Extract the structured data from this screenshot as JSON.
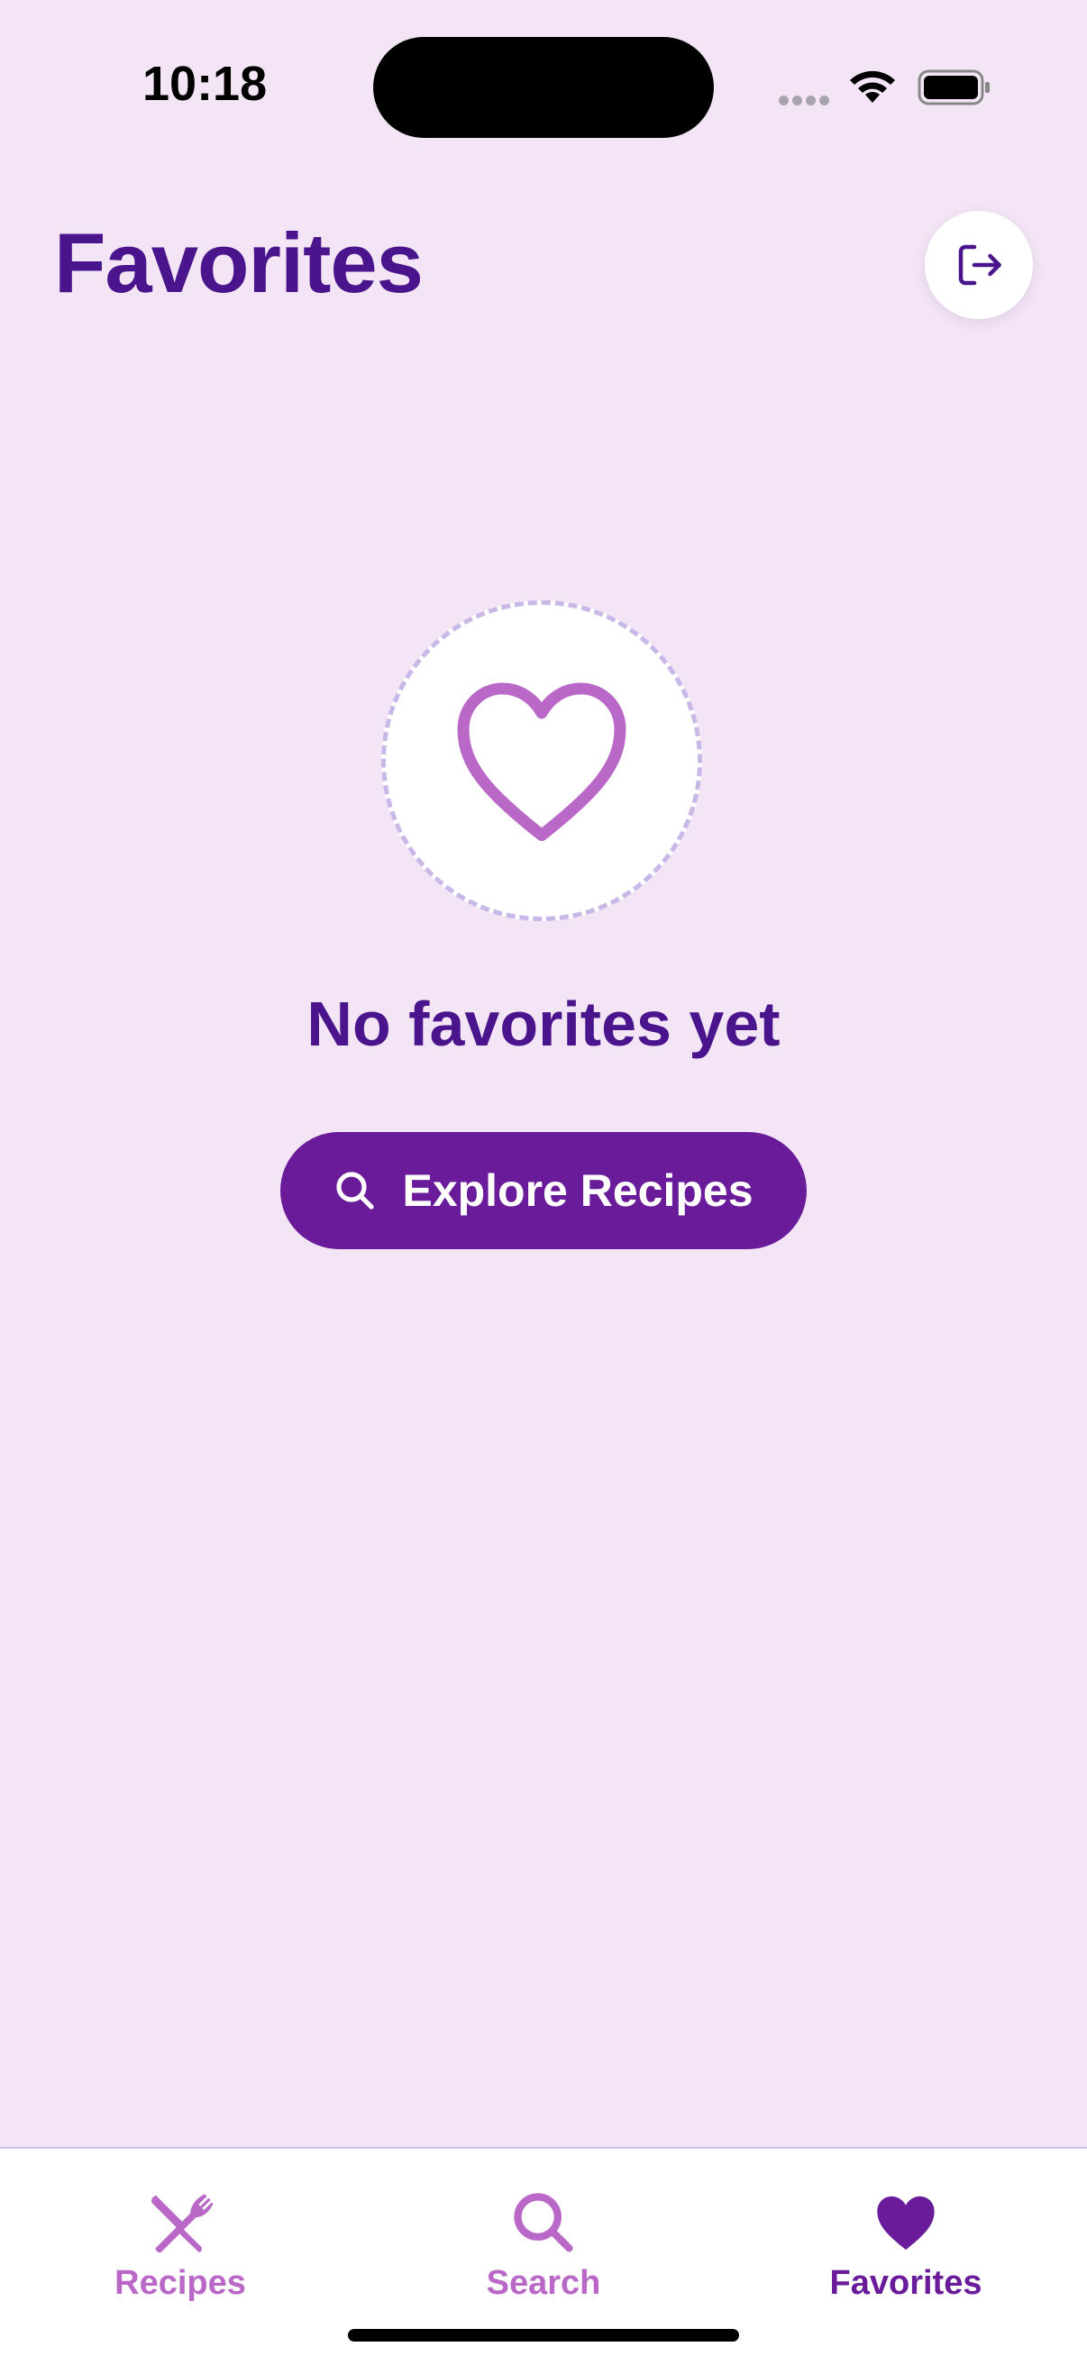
{
  "status_bar": {
    "time": "10:18"
  },
  "header": {
    "title": "Favorites",
    "logout_icon": "logout-icon"
  },
  "empty_state": {
    "icon": "heart-outline-icon",
    "title": "No favorites yet",
    "button_label": "Explore Recipes",
    "button_icon": "search-icon"
  },
  "tab_bar": {
    "items": [
      {
        "label": "Recipes",
        "icon": "utensils-icon",
        "active": false
      },
      {
        "label": "Search",
        "icon": "search-icon",
        "active": false
      },
      {
        "label": "Favorites",
        "icon": "heart-icon",
        "active": true
      }
    ]
  },
  "colors": {
    "background": "#f3e5f5",
    "primary_dark": "#4a148c",
    "button": "#6a1b9a",
    "accent_light": "#ba68c8",
    "tab_inactive": "#ba68c8",
    "tab_active": "#6a1b9a"
  }
}
